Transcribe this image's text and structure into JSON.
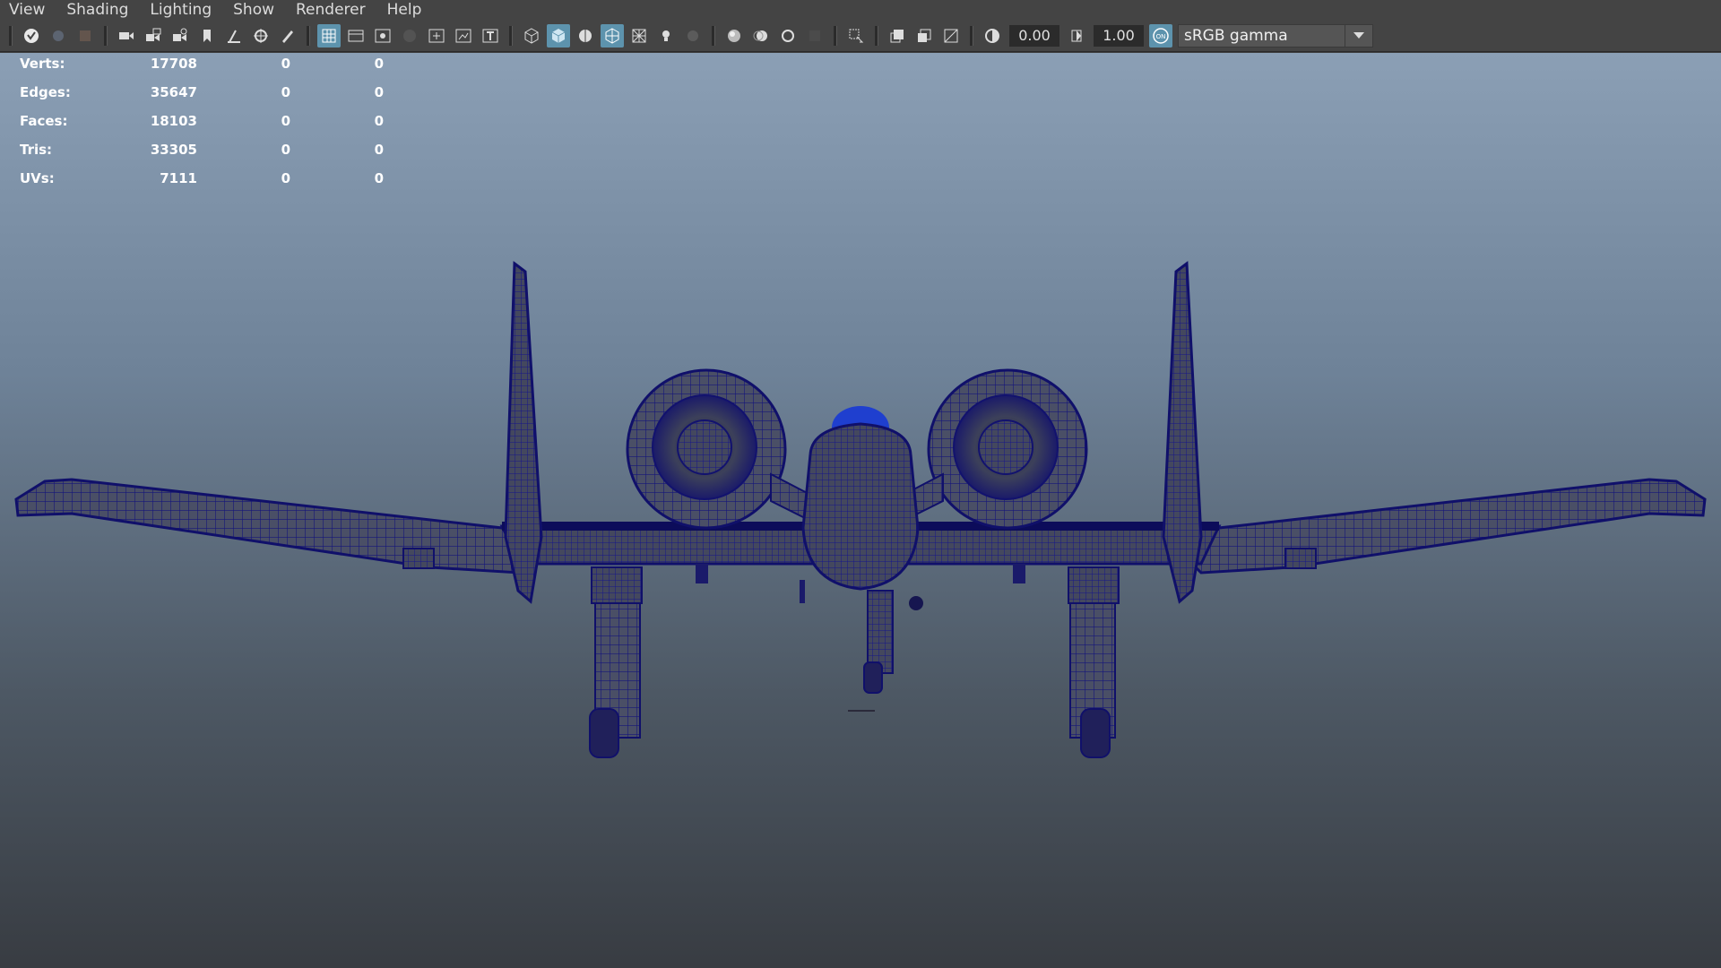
{
  "menu": [
    "View",
    "Shading",
    "Lighting",
    "Show",
    "Renderer",
    "Help"
  ],
  "toolbar": {
    "exposure_value": "0.00",
    "gamma_value": "1.00",
    "color_space": "sRGB gamma",
    "colors": {
      "active": "#5d93ad",
      "icon": "#d0d0d0"
    }
  },
  "hud": {
    "rows": [
      {
        "label": "Verts:",
        "v": "17708",
        "e": "0",
        "f": "0"
      },
      {
        "label": "Edges:",
        "v": "35647",
        "e": "0",
        "f": "0"
      },
      {
        "label": "Faces:",
        "v": "18103",
        "e": "0",
        "f": "0"
      },
      {
        "label": "Tris:",
        "v": "33305",
        "e": "0",
        "f": "0"
      },
      {
        "label": "UVs:",
        "v": "7111",
        "e": "0",
        "f": "0"
      }
    ]
  },
  "viewport": {
    "model": "aircraft-wireframe",
    "wire_color": "#1a1a8c"
  }
}
